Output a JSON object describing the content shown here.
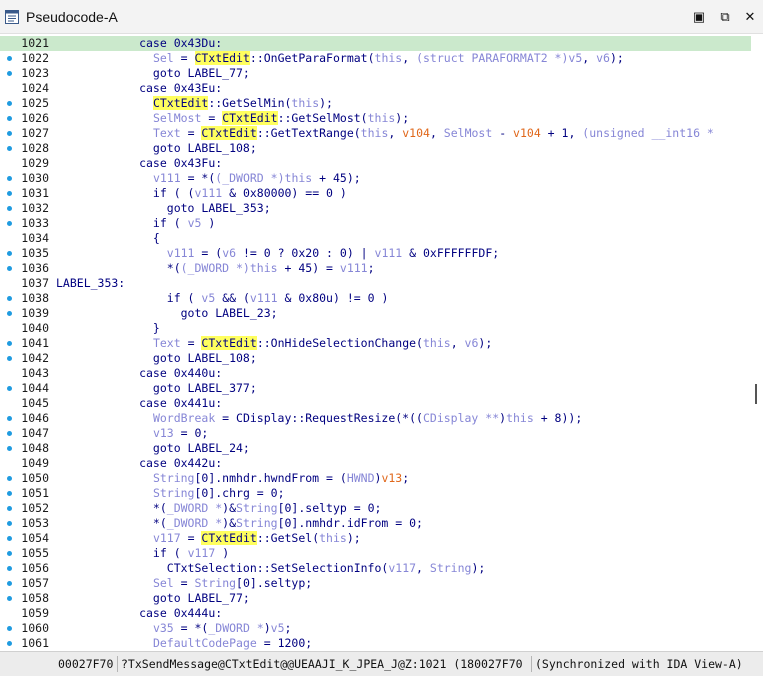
{
  "window": {
    "title": "Pseudocode-A",
    "float_icon": "▣",
    "dock_icon": "⧉",
    "close_icon": "✕"
  },
  "colors": {
    "current_line": "#cbe9cc",
    "highlight": "#ffff5e",
    "keyword": "#000080",
    "variable": "#8686d6",
    "local_var": "#e0671a",
    "breakpoint_dot": "#1f9be0"
  },
  "lines": [
    {
      "n": "1021",
      "dot": false,
      "segs": [
        [
          "n",
          "            case 0x43Du:"
        ]
      ]
    },
    {
      "n": "1022",
      "dot": true,
      "segs": [
        [
          "n",
          "              "
        ],
        [
          "v",
          "Sel"
        ],
        [
          "n",
          " = "
        ],
        [
          "h",
          "CTxtEdit"
        ],
        [
          "n",
          "::OnGetParaFormat("
        ],
        [
          "v",
          "this"
        ],
        [
          "n",
          ", "
        ],
        [
          "v",
          "(struct PARAFORMAT2 *)"
        ],
        [
          "v",
          "v5"
        ],
        [
          "n",
          ", "
        ],
        [
          "v",
          "v6"
        ],
        [
          "n",
          ");"
        ]
      ]
    },
    {
      "n": "1023",
      "dot": true,
      "segs": [
        [
          "n",
          "              goto LABEL_77;"
        ]
      ]
    },
    {
      "n": "1024",
      "dot": false,
      "segs": [
        [
          "n",
          "            case 0x43Eu:"
        ]
      ]
    },
    {
      "n": "1025",
      "dot": true,
      "segs": [
        [
          "n",
          "              "
        ],
        [
          "h",
          "CTxtEdit"
        ],
        [
          "n",
          "::GetSelMin("
        ],
        [
          "v",
          "this"
        ],
        [
          "n",
          ");"
        ]
      ]
    },
    {
      "n": "1026",
      "dot": true,
      "segs": [
        [
          "n",
          "              "
        ],
        [
          "v",
          "SelMost"
        ],
        [
          "n",
          " = "
        ],
        [
          "h",
          "CTxtEdit"
        ],
        [
          "n",
          "::GetSelMost("
        ],
        [
          "v",
          "this"
        ],
        [
          "n",
          ");"
        ]
      ]
    },
    {
      "n": "1027",
      "dot": true,
      "segs": [
        [
          "n",
          "              "
        ],
        [
          "v",
          "Text"
        ],
        [
          "n",
          " = "
        ],
        [
          "h",
          "CTxtEdit"
        ],
        [
          "n",
          "::GetTextRange("
        ],
        [
          "v",
          "this"
        ],
        [
          "n",
          ", "
        ],
        [
          "s",
          "v104"
        ],
        [
          "n",
          ", "
        ],
        [
          "v",
          "SelMost"
        ],
        [
          "n",
          " - "
        ],
        [
          "s",
          "v104"
        ],
        [
          "n",
          " + 1, "
        ],
        [
          "v",
          "(unsigned __int16 *"
        ]
      ]
    },
    {
      "n": "1028",
      "dot": true,
      "segs": [
        [
          "n",
          "              goto LABEL_108;"
        ]
      ]
    },
    {
      "n": "1029",
      "dot": false,
      "segs": [
        [
          "n",
          "            case 0x43Fu:"
        ]
      ]
    },
    {
      "n": "1030",
      "dot": true,
      "segs": [
        [
          "n",
          "              "
        ],
        [
          "v",
          "v111"
        ],
        [
          "n",
          " = *("
        ],
        [
          "v",
          "(_DWORD *)"
        ],
        [
          "v",
          "this"
        ],
        [
          "n",
          " + 45);"
        ]
      ]
    },
    {
      "n": "1031",
      "dot": true,
      "segs": [
        [
          "n",
          "              if ( ("
        ],
        [
          "v",
          "v111"
        ],
        [
          "n",
          " & 0x80000) == 0 )"
        ]
      ]
    },
    {
      "n": "1032",
      "dot": true,
      "segs": [
        [
          "n",
          "                goto LABEL_353;"
        ]
      ]
    },
    {
      "n": "1033",
      "dot": true,
      "segs": [
        [
          "n",
          "              if ( "
        ],
        [
          "v",
          "v5"
        ],
        [
          "n",
          " )"
        ]
      ]
    },
    {
      "n": "1034",
      "dot": false,
      "segs": [
        [
          "n",
          "              {"
        ]
      ]
    },
    {
      "n": "1035",
      "dot": true,
      "segs": [
        [
          "n",
          "                "
        ],
        [
          "v",
          "v111"
        ],
        [
          "n",
          " = ("
        ],
        [
          "v",
          "v6"
        ],
        [
          "n",
          " != 0 ? 0x20 : 0) | "
        ],
        [
          "v",
          "v111"
        ],
        [
          "n",
          " & 0xFFFFFFDF;"
        ]
      ]
    },
    {
      "n": "1036",
      "dot": true,
      "segs": [
        [
          "n",
          "                *("
        ],
        [
          "v",
          "(_DWORD *)"
        ],
        [
          "v",
          "this"
        ],
        [
          "n",
          " + 45) = "
        ],
        [
          "v",
          "v111"
        ],
        [
          "n",
          ";"
        ]
      ]
    },
    {
      "n": "1037",
      "dot": false,
      "segs": [
        [
          "n",
          "LABEL_353:"
        ]
      ]
    },
    {
      "n": "1038",
      "dot": true,
      "segs": [
        [
          "n",
          "                if ( "
        ],
        [
          "v",
          "v5"
        ],
        [
          "n",
          " && ("
        ],
        [
          "v",
          "v111"
        ],
        [
          "n",
          " & 0x80u) != 0 )"
        ]
      ]
    },
    {
      "n": "1039",
      "dot": true,
      "segs": [
        [
          "n",
          "                  goto LABEL_23;"
        ]
      ]
    },
    {
      "n": "1040",
      "dot": false,
      "segs": [
        [
          "n",
          "              }"
        ]
      ]
    },
    {
      "n": "1041",
      "dot": true,
      "segs": [
        [
          "n",
          "              "
        ],
        [
          "v",
          "Text"
        ],
        [
          "n",
          " = "
        ],
        [
          "h",
          "CTxtEdit"
        ],
        [
          "n",
          "::OnHideSelectionChange("
        ],
        [
          "v",
          "this"
        ],
        [
          "n",
          ", "
        ],
        [
          "v",
          "v6"
        ],
        [
          "n",
          ");"
        ]
      ]
    },
    {
      "n": "1042",
      "dot": true,
      "segs": [
        [
          "n",
          "              goto LABEL_108;"
        ]
      ]
    },
    {
      "n": "1043",
      "dot": false,
      "segs": [
        [
          "n",
          "            case 0x440u:"
        ]
      ]
    },
    {
      "n": "1044",
      "dot": true,
      "segs": [
        [
          "n",
          "              goto LABEL_377;"
        ]
      ]
    },
    {
      "n": "1045",
      "dot": false,
      "segs": [
        [
          "n",
          "            case 0x441u:"
        ]
      ]
    },
    {
      "n": "1046",
      "dot": true,
      "segs": [
        [
          "n",
          "              "
        ],
        [
          "v",
          "WordBreak"
        ],
        [
          "n",
          " = CDisplay::RequestResize(*(("
        ],
        [
          "v",
          "CDisplay **"
        ],
        [
          "n",
          ")"
        ],
        [
          "v",
          "this"
        ],
        [
          "n",
          " + 8));"
        ]
      ]
    },
    {
      "n": "1047",
      "dot": true,
      "segs": [
        [
          "n",
          "              "
        ],
        [
          "v",
          "v13"
        ],
        [
          "n",
          " = 0;"
        ]
      ]
    },
    {
      "n": "1048",
      "dot": true,
      "segs": [
        [
          "n",
          "              goto LABEL_24;"
        ]
      ]
    },
    {
      "n": "1049",
      "dot": false,
      "segs": [
        [
          "n",
          "            case 0x442u:"
        ]
      ]
    },
    {
      "n": "1050",
      "dot": true,
      "segs": [
        [
          "n",
          "              "
        ],
        [
          "v",
          "String"
        ],
        [
          "n",
          "[0].nmhdr.hwndFrom = ("
        ],
        [
          "v",
          "HWND"
        ],
        [
          "n",
          ")"
        ],
        [
          "s",
          "v13"
        ],
        [
          "n",
          ";"
        ]
      ]
    },
    {
      "n": "1051",
      "dot": true,
      "segs": [
        [
          "n",
          "              "
        ],
        [
          "v",
          "String"
        ],
        [
          "n",
          "[0].chrg = 0;"
        ]
      ]
    },
    {
      "n": "1052",
      "dot": true,
      "segs": [
        [
          "n",
          "              *("
        ],
        [
          "v",
          "_DWORD *"
        ],
        [
          "n",
          ")&"
        ],
        [
          "v",
          "String"
        ],
        [
          "n",
          "[0].seltyp = 0;"
        ]
      ]
    },
    {
      "n": "1053",
      "dot": true,
      "segs": [
        [
          "n",
          "              *("
        ],
        [
          "v",
          "_DWORD *"
        ],
        [
          "n",
          ")&"
        ],
        [
          "v",
          "String"
        ],
        [
          "n",
          "[0].nmhdr.idFrom = 0;"
        ]
      ]
    },
    {
      "n": "1054",
      "dot": true,
      "segs": [
        [
          "n",
          "              "
        ],
        [
          "v",
          "v117"
        ],
        [
          "n",
          " = "
        ],
        [
          "h",
          "CTxtEdit"
        ],
        [
          "n",
          "::GetSel("
        ],
        [
          "v",
          "this"
        ],
        [
          "n",
          ");"
        ]
      ]
    },
    {
      "n": "1055",
      "dot": true,
      "segs": [
        [
          "n",
          "              if ( "
        ],
        [
          "v",
          "v117"
        ],
        [
          "n",
          " )"
        ]
      ]
    },
    {
      "n": "1056",
      "dot": true,
      "segs": [
        [
          "n",
          "                CTxtSelection::SetSelectionInfo("
        ],
        [
          "v",
          "v117"
        ],
        [
          "n",
          ", "
        ],
        [
          "v",
          "String"
        ],
        [
          "n",
          ");"
        ]
      ]
    },
    {
      "n": "1057",
      "dot": true,
      "segs": [
        [
          "n",
          "              "
        ],
        [
          "v",
          "Sel"
        ],
        [
          "n",
          " = "
        ],
        [
          "v",
          "String"
        ],
        [
          "n",
          "[0].seltyp;"
        ]
      ]
    },
    {
      "n": "1058",
      "dot": true,
      "segs": [
        [
          "n",
          "              goto LABEL_77;"
        ]
      ]
    },
    {
      "n": "1059",
      "dot": false,
      "segs": [
        [
          "n",
          "            case 0x444u:"
        ]
      ]
    },
    {
      "n": "1060",
      "dot": true,
      "segs": [
        [
          "n",
          "              "
        ],
        [
          "v",
          "v35"
        ],
        [
          "n",
          " = *("
        ],
        [
          "v",
          "_DWORD *"
        ],
        [
          "n",
          ")"
        ],
        [
          "v",
          "v5"
        ],
        [
          "n",
          ";"
        ]
      ]
    },
    {
      "n": "1061",
      "dot": true,
      "segs": [
        [
          "n",
          "              "
        ],
        [
          "v",
          "DefaultCodePage"
        ],
        [
          "n",
          " = 1200;"
        ]
      ]
    }
  ],
  "status": {
    "address": "00027F70",
    "function": "?TxSendMessage@CTxtEdit@@UEAAJI_K_JPEA_J@Z:1021 (180027F70",
    "sync": "(Synchronized with IDA View-A)"
  }
}
